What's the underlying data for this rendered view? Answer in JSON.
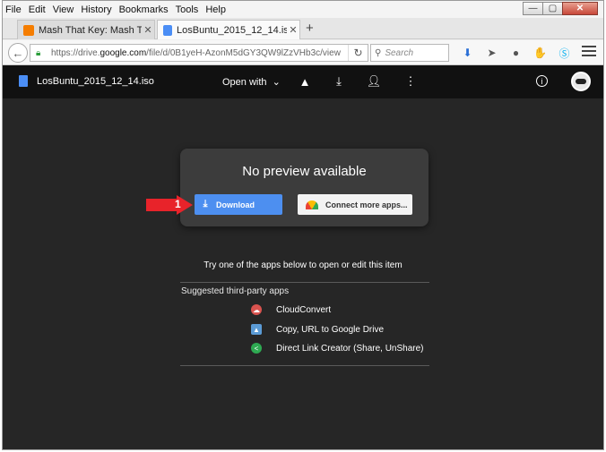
{
  "menubar": {
    "items": [
      "File",
      "Edit",
      "View",
      "History",
      "Bookmarks",
      "Tools",
      "Help"
    ]
  },
  "window_controls": {
    "minimize": "—",
    "maximize": "▢",
    "close": "✕"
  },
  "tabs": [
    {
      "label": "Mash That Key: Mash That ...",
      "icon": "blogger-icon",
      "color": "#f57d00"
    },
    {
      "label": "LosBuntu_2015_12_14.iso - ...",
      "icon": "drive-doc-icon",
      "color": "#4b8ef5"
    }
  ],
  "navbar": {
    "url_prefix": "https://drive.",
    "url_domain": "google.com",
    "url_suffix": "/file/d/0B1yeH-AzonM5dGY3QW9lZzVHb3c/view",
    "search_placeholder": "Search"
  },
  "drive": {
    "filename": "LosBuntu_2015_12_14.iso",
    "open_with": "Open with",
    "no_preview": "No preview available",
    "download_label": "Download",
    "connect_label": "Connect more apps...",
    "callout_number": "1",
    "try_text": "Try one of the apps below to open or edit this item",
    "suggested_title": "Suggested third-party apps",
    "apps": [
      {
        "name": "CloudConvert",
        "color": "#d9534f"
      },
      {
        "name": "Copy, URL to Google Drive",
        "color": "#5b9bd5"
      },
      {
        "name": "Direct Link Creator (Share, UnShare)",
        "color": "#2eaa52"
      }
    ]
  },
  "colors": {
    "download_button": "#4d8ff0",
    "callout_arrow": "#e8232a",
    "drive_bg": "#262626"
  }
}
